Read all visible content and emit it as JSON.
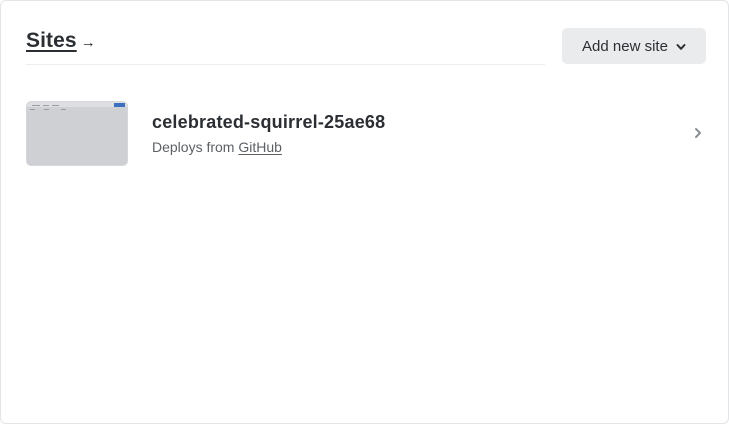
{
  "header": {
    "title": "Sites",
    "arrow": "→"
  },
  "actions": {
    "add_new_site": "Add new site"
  },
  "sites": [
    {
      "name": "celebrated-squirrel-25ae68",
      "deploys_prefix": "Deploys from",
      "deploys_source": "GitHub"
    }
  ],
  "icons": {
    "add_dropdown": "chevron-down-icon",
    "row_open": "chevron-right-icon"
  },
  "colors": {
    "button_bg": "#e9ebed",
    "text": "#2b2f33",
    "muted": "#5c6166",
    "thumbnail_accent": "#3b6fc0"
  }
}
